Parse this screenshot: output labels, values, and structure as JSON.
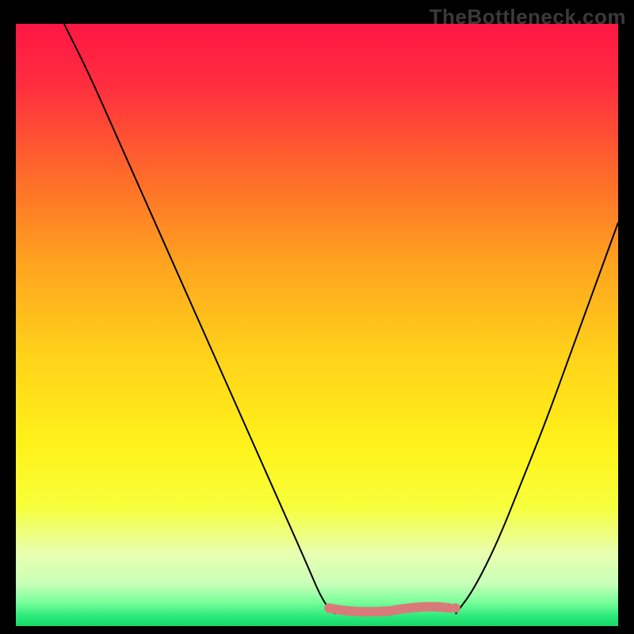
{
  "watermark": "TheBottleneck.com",
  "chart_data": {
    "type": "line",
    "title": "",
    "xlabel": "",
    "ylabel": "",
    "xlim": [
      0,
      100
    ],
    "ylim": [
      0,
      100
    ],
    "curve_left": {
      "x": [
        8,
        12,
        16,
        20,
        24,
        28,
        32,
        36,
        40,
        44,
        48,
        51,
        53
      ],
      "y": [
        100,
        92,
        83,
        74,
        65,
        56,
        47,
        38,
        29,
        20,
        11,
        4,
        2
      ]
    },
    "curve_right": {
      "x": [
        73,
        76,
        80,
        84,
        88,
        92,
        96,
        100
      ],
      "y": [
        2,
        6,
        14,
        24,
        34,
        45,
        56,
        67
      ]
    },
    "flat_zone": {
      "x_start": 53,
      "x_end": 73,
      "y": 2
    },
    "marker_segment": {
      "x_start": 52,
      "x_end": 72,
      "y": 3,
      "color": "#d97a7a",
      "end_dot_x": 73,
      "end_dot_y": 3
    },
    "background_gradient": {
      "stops": [
        {
          "offset": 0.0,
          "color": "#ff1744"
        },
        {
          "offset": 0.1,
          "color": "#ff2d3f"
        },
        {
          "offset": 0.25,
          "color": "#ff6a2a"
        },
        {
          "offset": 0.4,
          "color": "#ffa41f"
        },
        {
          "offset": 0.55,
          "color": "#ffd21a"
        },
        {
          "offset": 0.7,
          "color": "#fff21a"
        },
        {
          "offset": 0.8,
          "color": "#f7ff3a"
        },
        {
          "offset": 0.88,
          "color": "#e8ffb0"
        },
        {
          "offset": 0.93,
          "color": "#c8ffb8"
        },
        {
          "offset": 0.96,
          "color": "#7aff9a"
        },
        {
          "offset": 0.985,
          "color": "#29e87a"
        },
        {
          "offset": 1.0,
          "color": "#18d86a"
        }
      ]
    }
  }
}
